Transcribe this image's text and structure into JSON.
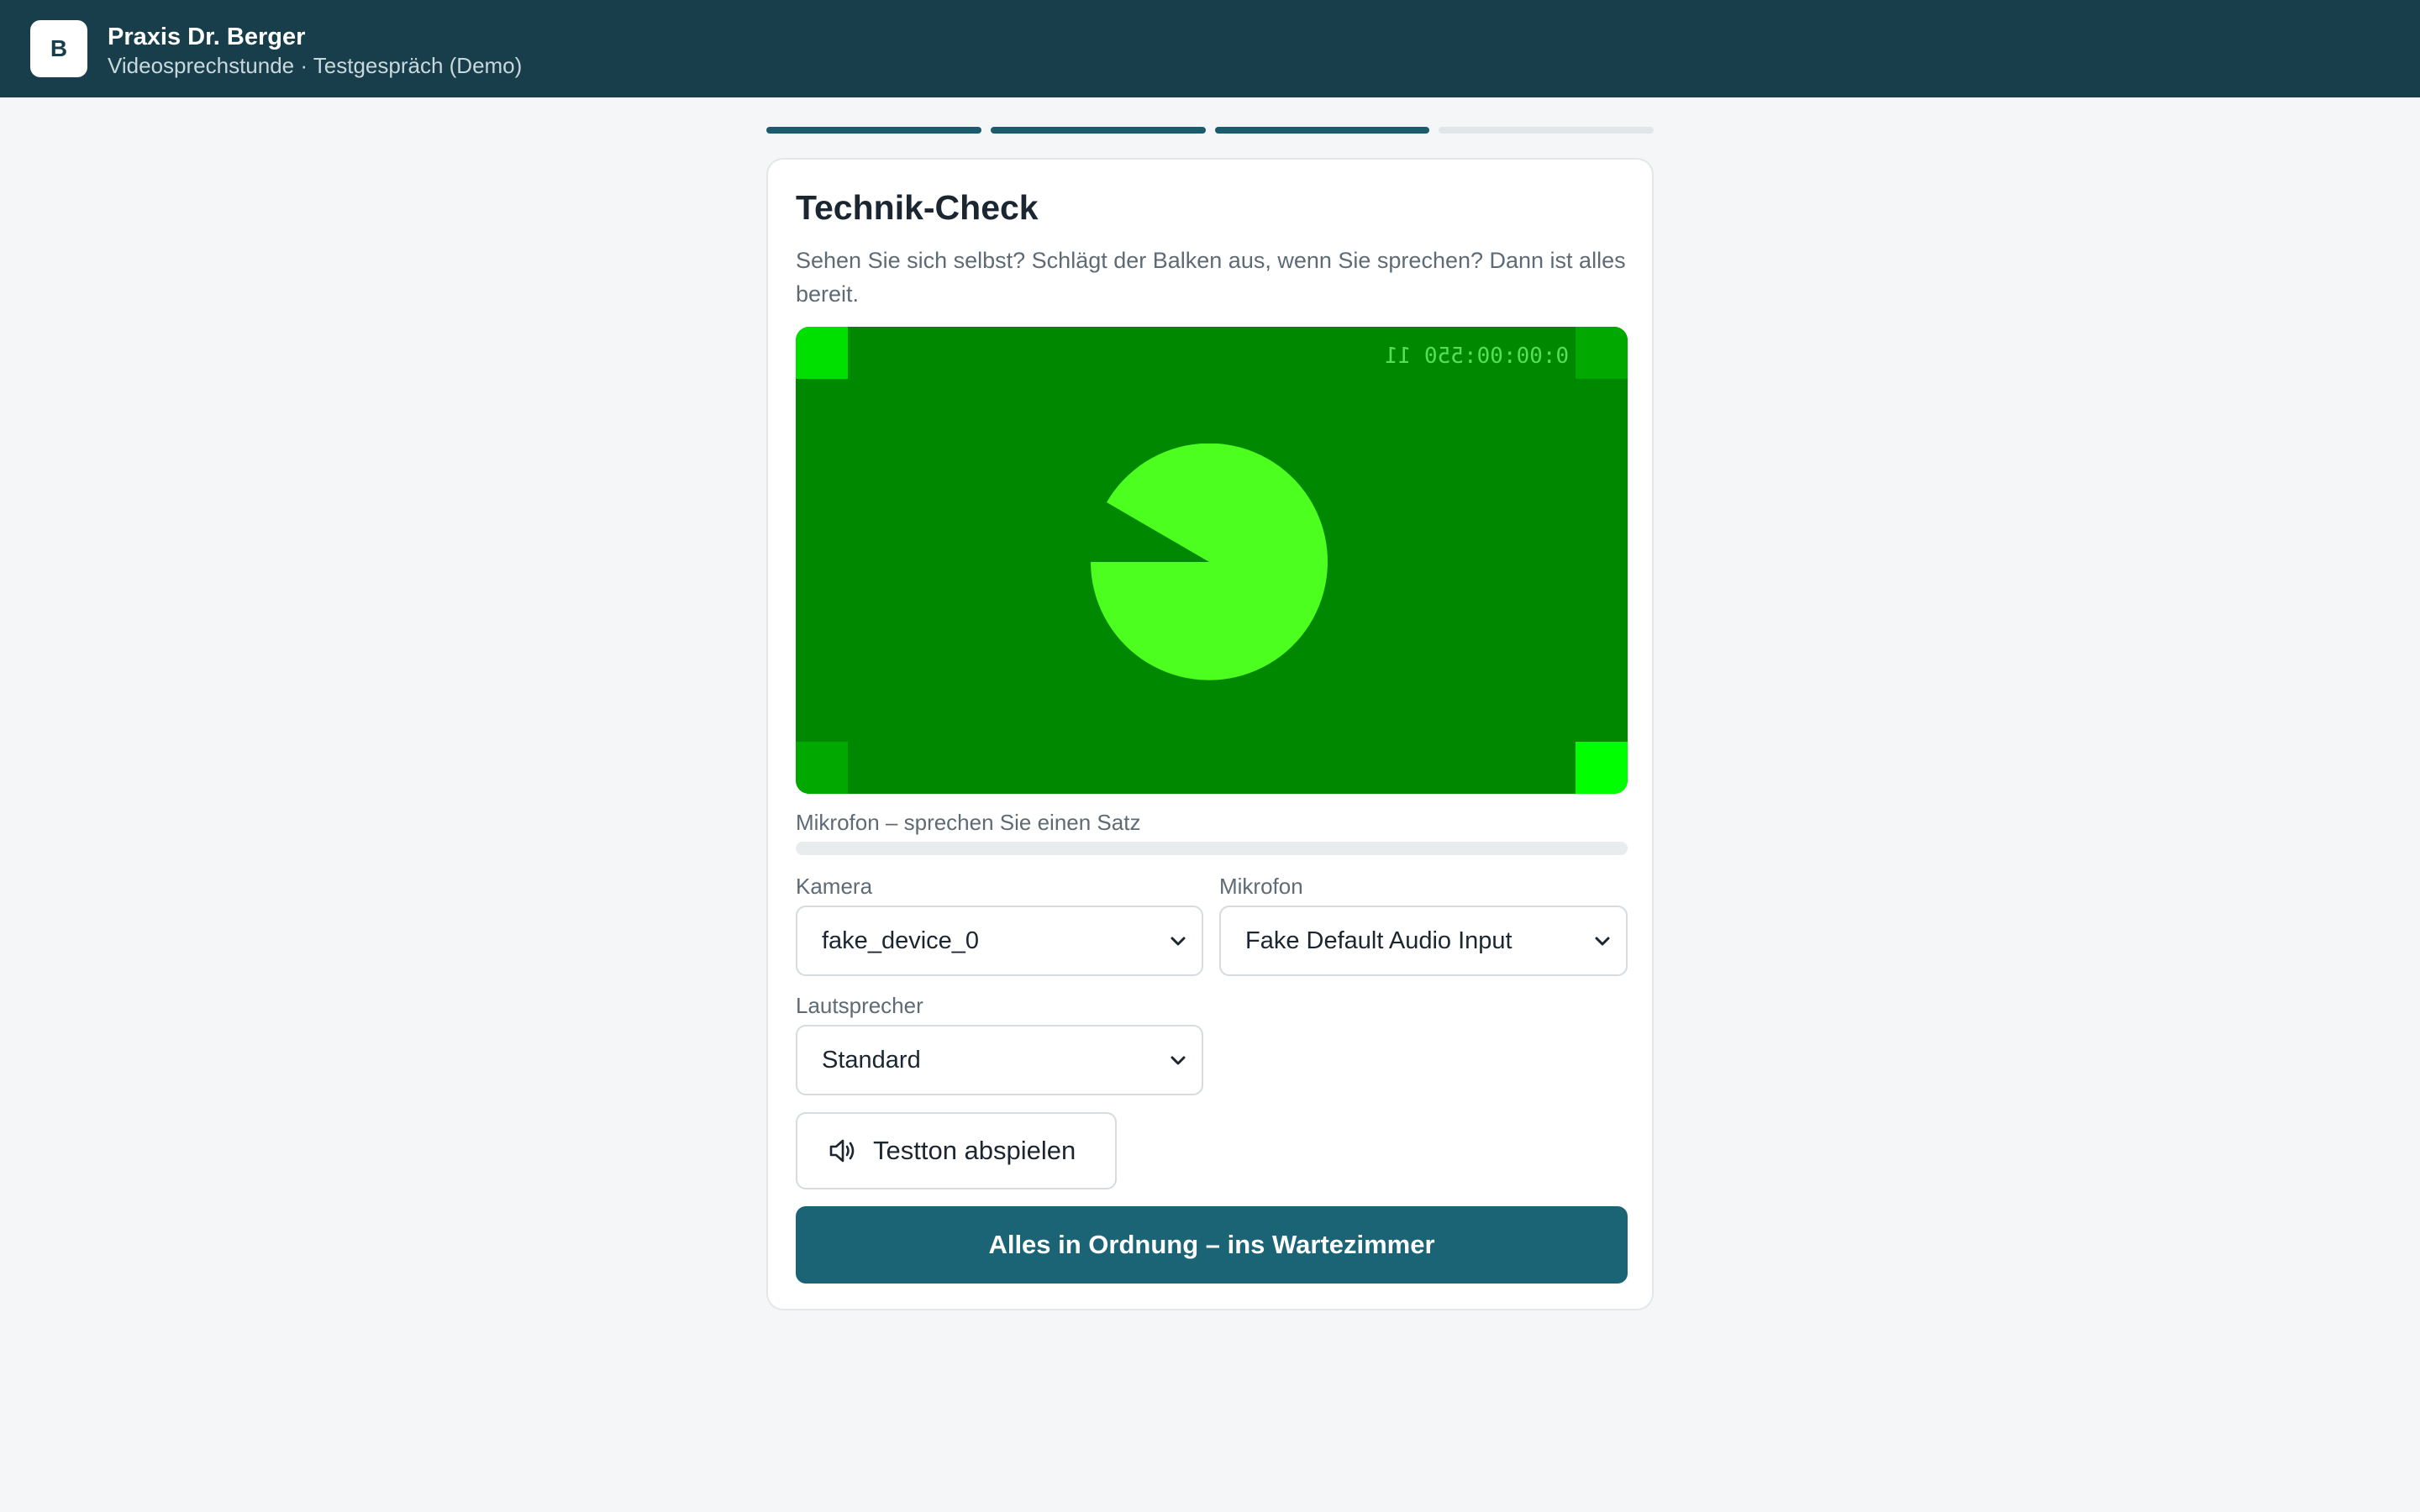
{
  "header": {
    "badge": "B",
    "title": "Praxis Dr. Berger",
    "subtitle": "Videosprechstunde · Testgespräch (Demo)"
  },
  "progress": {
    "total_steps": 4,
    "completed_steps": 3
  },
  "card": {
    "title": "Technik-Check",
    "description": "Sehen Sie sich selbst? Schlägt der Balken aus, wenn Sie sprechen? Dann ist alles bereit."
  },
  "video": {
    "timestamp": "0:00:00:550 11",
    "background_color": "#008800",
    "shape_color": "#4cff1f"
  },
  "mic_meter": {
    "label": "Mikrofon – sprechen Sie einen Satz",
    "level": 0
  },
  "fields": {
    "camera": {
      "label": "Kamera",
      "value": "fake_device_0"
    },
    "microphone": {
      "label": "Mikrofon",
      "value": "Fake Default Audio Input"
    },
    "speaker": {
      "label": "Lautsprecher",
      "value": "Standard"
    }
  },
  "buttons": {
    "test_tone": {
      "label": "Testton abspielen",
      "icon": "speaker-icon"
    },
    "continue": {
      "label": "Alles in Ordnung – ins Wartezimmer"
    }
  },
  "colors": {
    "brand": "#173e4a",
    "primary": "#1b6475",
    "progress_done": "#1c5b6c"
  }
}
